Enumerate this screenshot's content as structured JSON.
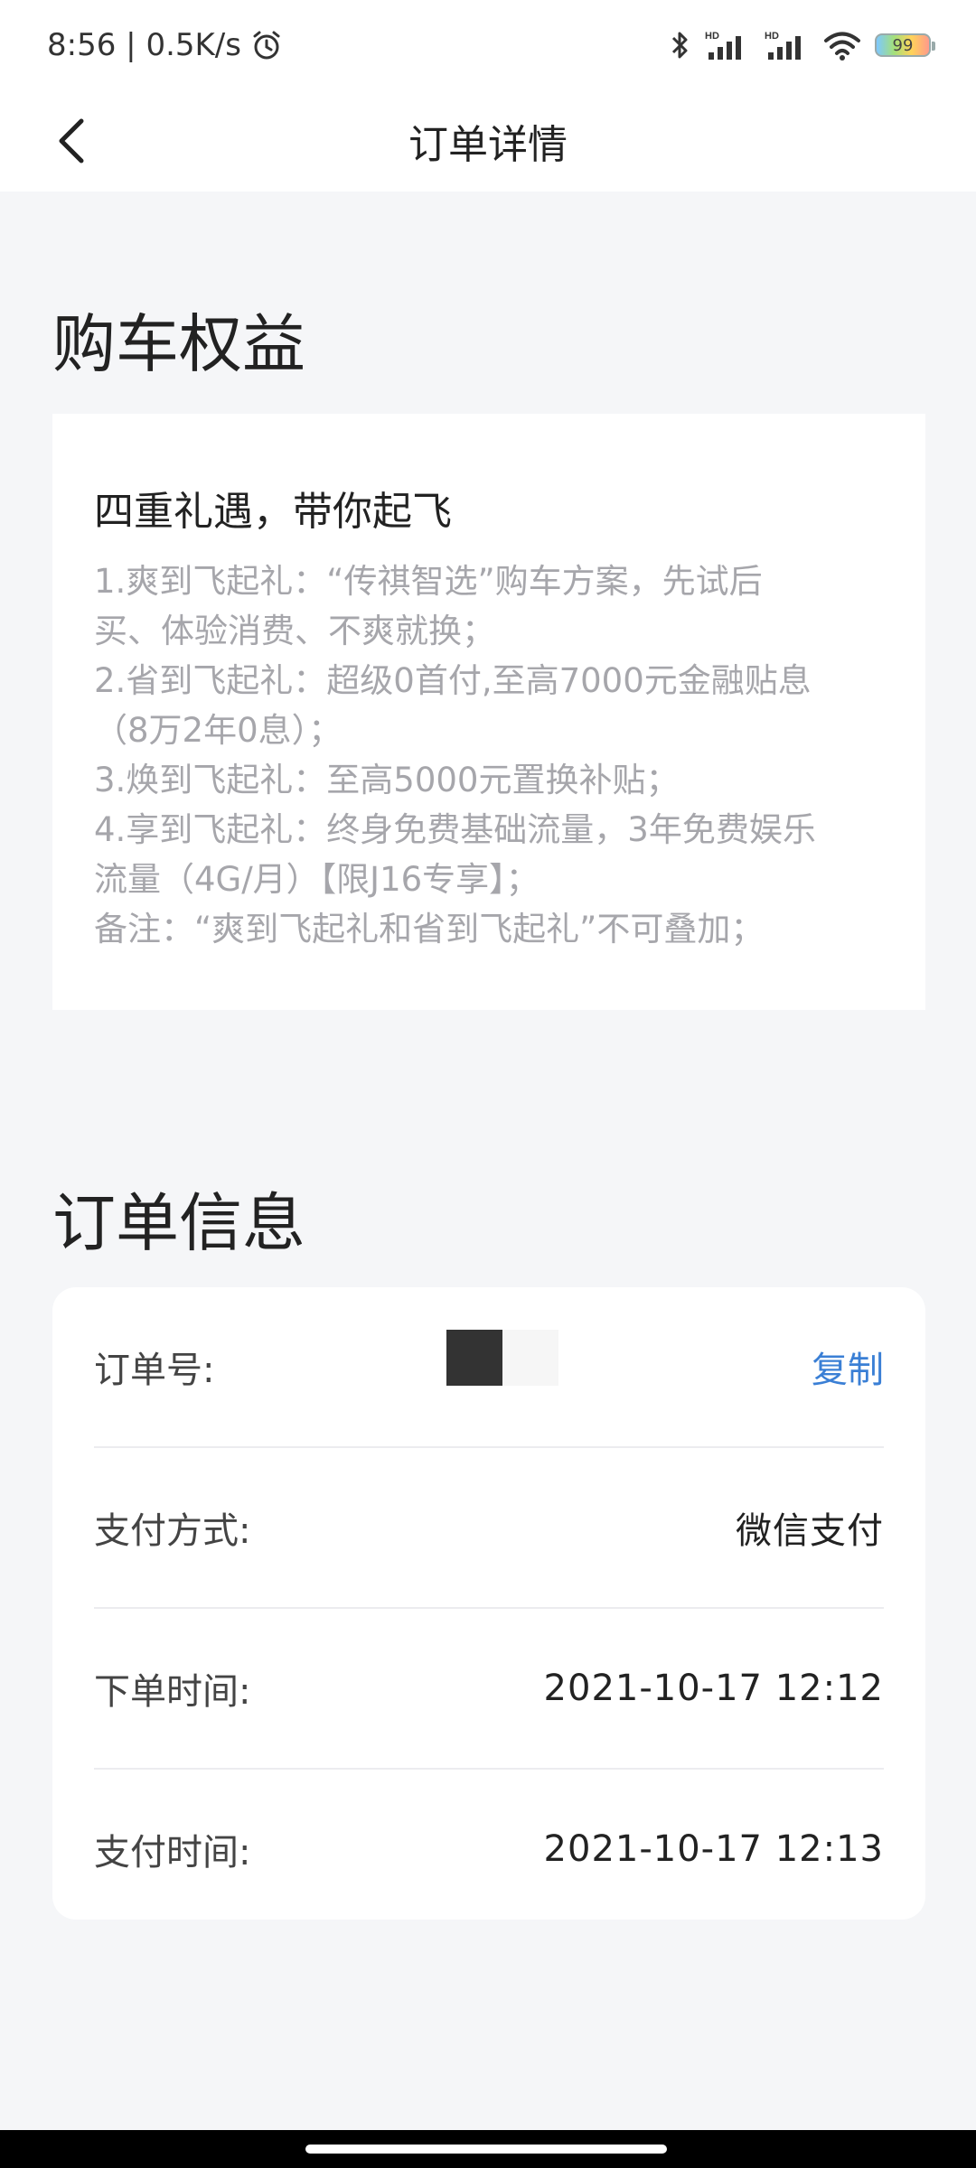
{
  "status_bar": {
    "time": "8:56",
    "network_speed": "0.5K/s",
    "battery_level": "99",
    "icons": [
      "alarm-icon",
      "bluetooth-icon",
      "signal-hd-icon",
      "signal-hd-icon",
      "wifi-icon",
      "battery-icon"
    ]
  },
  "nav": {
    "title": "订单详情",
    "back_icon": "chevron-left-icon"
  },
  "benefits": {
    "section_title": "购车权益",
    "heading": "四重礼遇，带你起飞",
    "lines": [
      "1.爽到飞起礼：“传祺智选”购车方案，先试后\n买、体验消费、不爽就换；",
      "2.省到飞起礼：超级0首付,至高7000元金融贴息\n（8万2年0息）；",
      "3.焕到飞起礼：至高5000元置换补贴；",
      "4.享到飞起礼：终身免费基础流量，3年免费娱乐\n流量（4G/月）【限J16专享】；",
      "备注：“爽到飞起礼和省到飞起礼”不可叠加；"
    ]
  },
  "order": {
    "section_title": "订单信息",
    "order_no_label": "订单号:",
    "copy_label": "复制",
    "payment_method_label": "支付方式:",
    "payment_method_value": "微信支付",
    "order_time_label": "下单时间:",
    "order_time_value": "2021-10-17 12:12",
    "pay_time_label": "支付时间:",
    "pay_time_value": "2021-10-17 12:13"
  },
  "colors": {
    "accent": "#3a7fd5",
    "background": "#f5f6f8",
    "muted_text": "#a6a6ab"
  }
}
